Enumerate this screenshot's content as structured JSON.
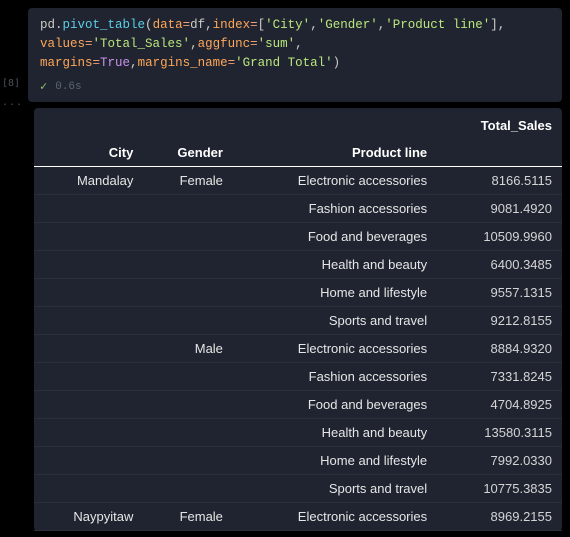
{
  "cell_exec_label": "[8]",
  "dots": "...",
  "status": {
    "time": "0.6s"
  },
  "code": {
    "fn1": "pd",
    "dot1": ".",
    "fn2": "pivot_table",
    "lp": "(",
    "a_data": "data",
    "eq": "=",
    "v_data": "df",
    "comma": ",",
    "a_index": "index",
    "lb": "[",
    "s_city": "'City'",
    "s_gender": "'Gender'",
    "s_prod": "'Product line'",
    "rb": "]",
    "a_values": "values",
    "s_totsales": "'Total_Sales'",
    "a_aggfunc": "aggfunc",
    "s_sum": "'sum'",
    "a_margins": "margins",
    "v_true": "True",
    "a_mname": "margins_name",
    "s_gt": "'Grand Total'",
    "rp": ")"
  },
  "table": {
    "value_header": "Total_Sales",
    "idx_headers": {
      "city": "City",
      "gender": "Gender",
      "product": "Product line"
    },
    "rows": [
      {
        "city": "Mandalay",
        "gender": "Female",
        "product": "Electronic accessories",
        "value": "8166.5115"
      },
      {
        "city": "",
        "gender": "",
        "product": "Fashion accessories",
        "value": "9081.4920"
      },
      {
        "city": "",
        "gender": "",
        "product": "Food and beverages",
        "value": "10509.9960"
      },
      {
        "city": "",
        "gender": "",
        "product": "Health and beauty",
        "value": "6400.3485"
      },
      {
        "city": "",
        "gender": "",
        "product": "Home and lifestyle",
        "value": "9557.1315"
      },
      {
        "city": "",
        "gender": "",
        "product": "Sports and travel",
        "value": "9212.8155"
      },
      {
        "city": "",
        "gender": "Male",
        "product": "Electronic accessories",
        "value": "8884.9320"
      },
      {
        "city": "",
        "gender": "",
        "product": "Fashion accessories",
        "value": "7331.8245"
      },
      {
        "city": "",
        "gender": "",
        "product": "Food and beverages",
        "value": "4704.8925"
      },
      {
        "city": "",
        "gender": "",
        "product": "Health and beauty",
        "value": "13580.3115"
      },
      {
        "city": "",
        "gender": "",
        "product": "Home and lifestyle",
        "value": "7992.0330"
      },
      {
        "city": "",
        "gender": "",
        "product": "Sports and travel",
        "value": "10775.3835"
      },
      {
        "city": "Naypyitaw",
        "gender": "Female",
        "product": "Electronic accessories",
        "value": "8969.2155"
      }
    ]
  }
}
